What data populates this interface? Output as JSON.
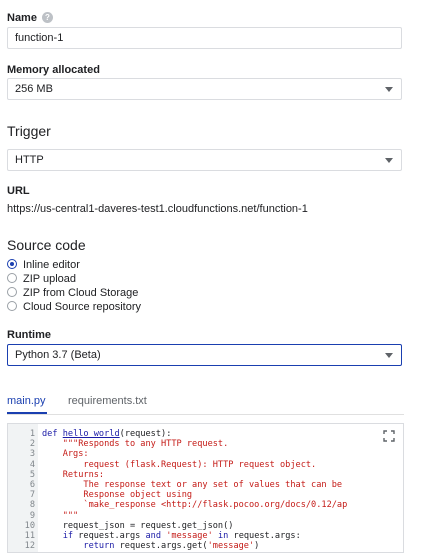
{
  "name": {
    "label": "Name",
    "help_icon": "question-mark-icon",
    "value": "function-1"
  },
  "memory": {
    "label": "Memory allocated",
    "value": "256 MB"
  },
  "trigger": {
    "title": "Trigger",
    "value": "HTTP"
  },
  "url": {
    "label": "URL",
    "value": "https://us-central1-daveres-test1.cloudfunctions.net/function-1"
  },
  "source": {
    "title": "Source code",
    "options": [
      {
        "label": "Inline editor",
        "checked": true
      },
      {
        "label": "ZIP upload",
        "checked": false
      },
      {
        "label": "ZIP from Cloud Storage",
        "checked": false
      },
      {
        "label": "Cloud Source repository",
        "checked": false
      }
    ]
  },
  "runtime": {
    "label": "Runtime",
    "value": "Python 3.7 (Beta)"
  },
  "tabs": [
    {
      "label": "main.py",
      "active": true
    },
    {
      "label": "requirements.txt",
      "active": false
    }
  ],
  "editor": {
    "fullscreen_icon": "fullscreen-icon",
    "lines": [
      {
        "n": "1",
        "text": "def hello_world(request):"
      },
      {
        "n": "2",
        "text": "    \"\"\"Responds to any HTTP request."
      },
      {
        "n": "3",
        "text": "    Args:"
      },
      {
        "n": "4",
        "text": "        request (flask.Request): HTTP request object."
      },
      {
        "n": "5",
        "text": "    Returns:"
      },
      {
        "n": "6",
        "text": "        The response text or any set of values that can be"
      },
      {
        "n": "7",
        "text": "        Response object using"
      },
      {
        "n": "8",
        "text": "        `make_response <http://flask.pocoo.org/docs/0.12/ap"
      },
      {
        "n": "9",
        "text": "    \"\"\""
      },
      {
        "n": "10",
        "text": "    request_json = request.get_json()"
      },
      {
        "n": "11",
        "text": "    if request.args and 'message' in request.args:"
      },
      {
        "n": "12",
        "text": "        return request.args.get('message')"
      }
    ]
  },
  "colors": {
    "accent": "#1a3fb0",
    "border": "#dadce0",
    "string": "#c41a16",
    "keyword": "#1a1aa6"
  }
}
